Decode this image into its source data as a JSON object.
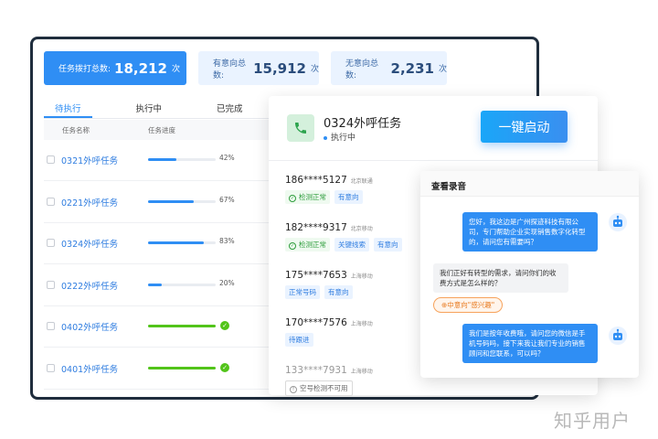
{
  "stats": {
    "total": {
      "label": "任务拨打总数:",
      "value": "18,212",
      "unit": "次"
    },
    "interested": {
      "label": "有意向总数:",
      "value": "15,912",
      "unit": "次"
    },
    "not_interested": {
      "label": "无意向总数:",
      "value": "2,231",
      "unit": "次"
    }
  },
  "tabs": [
    "待执行",
    "执行中",
    "已完成"
  ],
  "table": {
    "headers": [
      "任务名称",
      "任务进度"
    ],
    "rows": [
      {
        "name": "0321外呼任务",
        "progress": 0.42,
        "progress_label": "42%",
        "done": false
      },
      {
        "name": "0221外呼任务",
        "progress": 0.67,
        "progress_label": "67%",
        "done": false
      },
      {
        "name": "0324外呼任务",
        "progress": 0.83,
        "progress_label": "83%",
        "done": false
      },
      {
        "name": "0222外呼任务",
        "progress": 0.2,
        "progress_label": "20%",
        "done": false
      },
      {
        "name": "0402外呼任务",
        "progress": 1.0,
        "progress_label": "",
        "done": true
      },
      {
        "name": "0401外呼任务",
        "progress": 1.0,
        "progress_label": "",
        "done": true
      }
    ]
  },
  "task_card": {
    "title": "0324外呼任务",
    "status": "执行中",
    "start_button": "一键启动",
    "calls": [
      {
        "phone": "186****5127",
        "carrier": "北京联通",
        "dim": false,
        "tags": [
          {
            "text": "检测正常",
            "kind": "ok"
          },
          {
            "text": "有意向",
            "kind": "blue"
          }
        ]
      },
      {
        "phone": "182****9317",
        "carrier": "北京移动",
        "dim": false,
        "tags": [
          {
            "text": "检测正常",
            "kind": "ok"
          },
          {
            "text": "关键线索",
            "kind": "blue"
          },
          {
            "text": "有意向",
            "kind": "blue"
          }
        ]
      },
      {
        "phone": "175****7653",
        "carrier": "上海移动",
        "dim": false,
        "tags": [
          {
            "text": "正常号码",
            "kind": "blue"
          },
          {
            "text": "有意向",
            "kind": "blue"
          }
        ]
      },
      {
        "phone": "170****7576",
        "carrier": "上海移动",
        "dim": false,
        "tags": [
          {
            "text": "待跟进",
            "kind": "blue"
          }
        ]
      },
      {
        "phone": "133****7931",
        "carrier": "上海移动",
        "dim": true,
        "tags": [
          {
            "text": "空号检测不可用",
            "kind": "bad"
          }
        ]
      }
    ]
  },
  "recording": {
    "title": "查看录音",
    "messages": [
      {
        "side": "out",
        "text": "您好，我这边是广州探迹科技有限公司，专门帮助企业实现销售数字化转型的，请问您有需要吗？"
      },
      {
        "side": "in",
        "text": "我们正好有转型的需求，请问你们的收费方式是怎么样的？"
      },
      {
        "side": "out",
        "text": "我们是按年收费哦，请问您的微信是手机号码吗，接下来我让我们专业的销售顾问和您联系，可以吗？"
      }
    ],
    "intent_tag": "⊕中意向\"感兴趣\""
  },
  "watermark": "知乎用户",
  "colors": {
    "primary": "#2f8ef4",
    "success": "#52c41a",
    "intent": "#e87a1f"
  }
}
